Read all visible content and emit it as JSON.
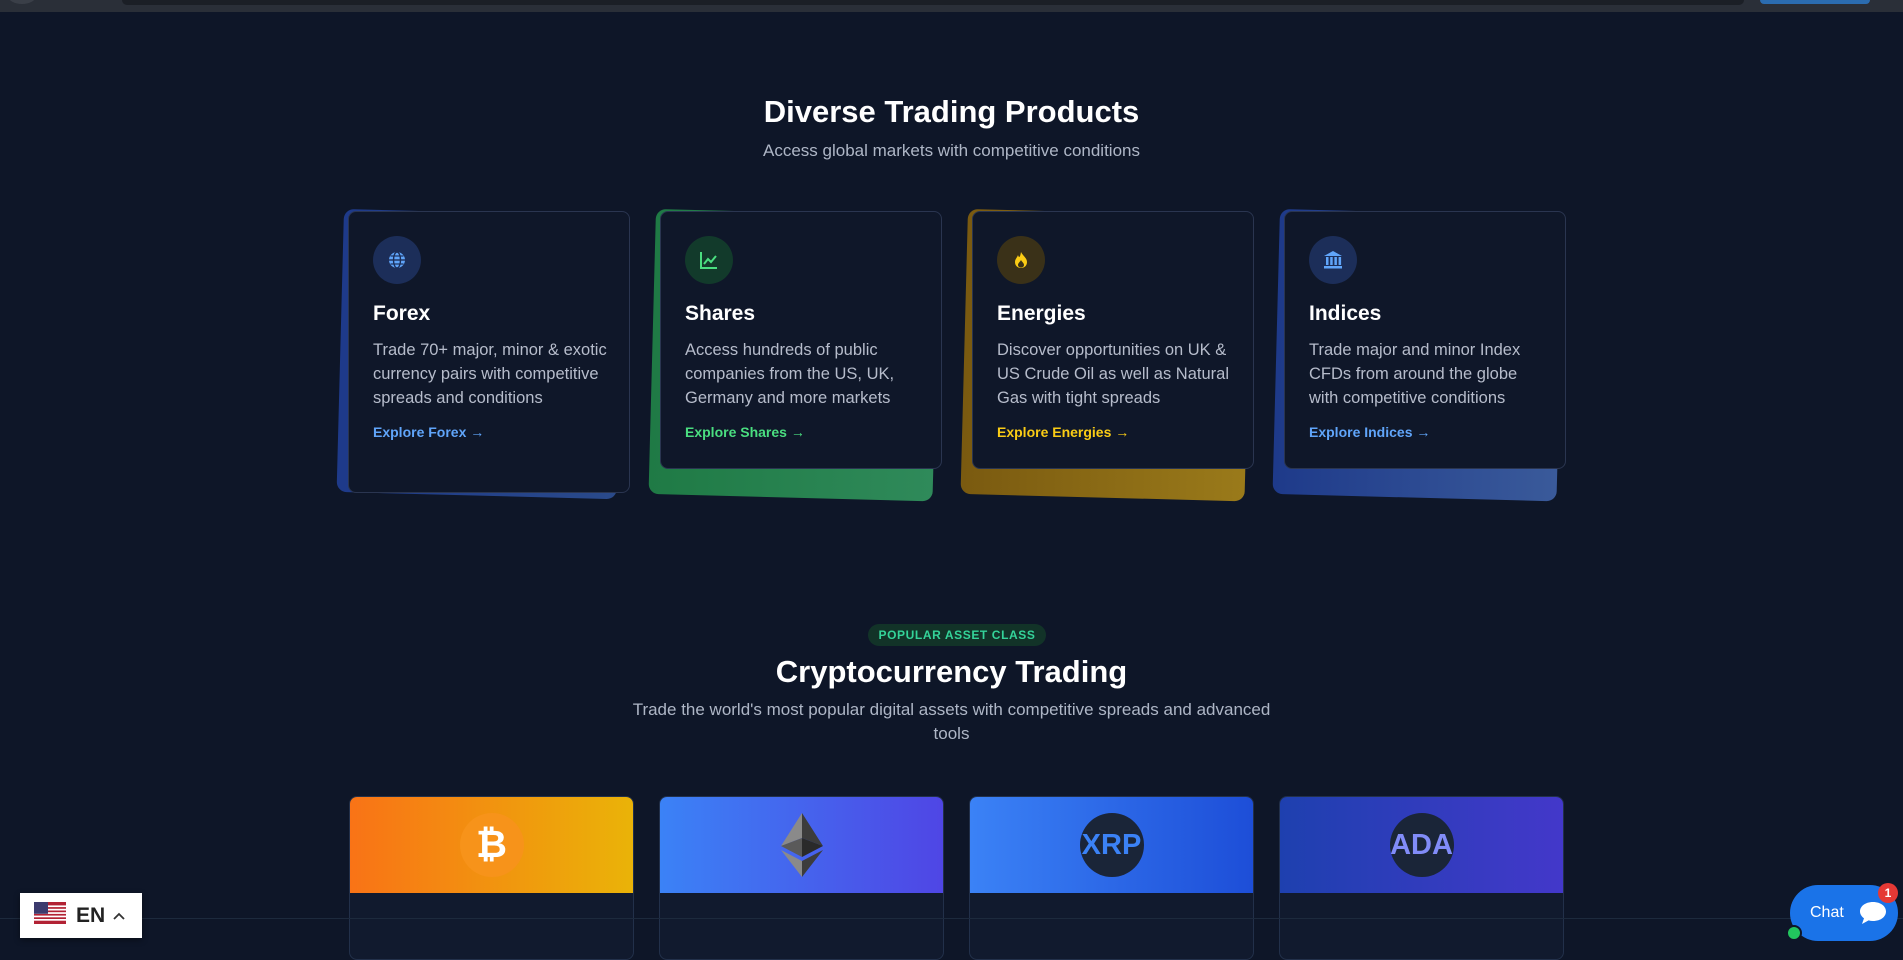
{
  "products": {
    "title": "Diverse Trading Products",
    "subtitle": "Access global markets with competitive conditions",
    "cards": [
      {
        "title": "Forex",
        "desc": "Trade 70+ major, minor & exotic currency pairs with competitive spreads and conditions",
        "link": "Explore Forex →",
        "icon": "globe-icon",
        "accent": "#60a5fa"
      },
      {
        "title": "Shares",
        "desc": "Access hundreds of public companies from the US, UK, Germany and more markets",
        "link": "Explore Shares →",
        "icon": "chart-line-icon",
        "accent": "#4ade80"
      },
      {
        "title": "Energies",
        "desc": "Discover opportunities on UK & US Crude Oil as well as Natural Gas with tight spreads",
        "link": "Explore Energies →",
        "icon": "fire-icon",
        "accent": "#facc15"
      },
      {
        "title": "Indices",
        "desc": "Trade major and minor Index CFDs from around the globe with competitive conditions",
        "link": "Explore Indices →",
        "icon": "bank-icon",
        "accent": "#60a5fa"
      }
    ]
  },
  "crypto": {
    "badge": "POPULAR ASSET CLASS",
    "title": "Cryptocurrency Trading",
    "subtitle_line1": "Trade the world's most popular digital assets with competitive spreads and advanced",
    "subtitle_line2": "tools",
    "coins": [
      {
        "symbol": "₿",
        "icon": "bitcoin-icon"
      },
      {
        "symbol": "",
        "icon": "ethereum-icon"
      },
      {
        "symbol": "XRP",
        "icon": "xrp-icon"
      },
      {
        "symbol": "ADA",
        "icon": "cardano-icon"
      }
    ]
  },
  "language": {
    "code": "EN",
    "icon": "us-flag-icon"
  },
  "chat": {
    "label": "Chat",
    "badge": "1"
  }
}
